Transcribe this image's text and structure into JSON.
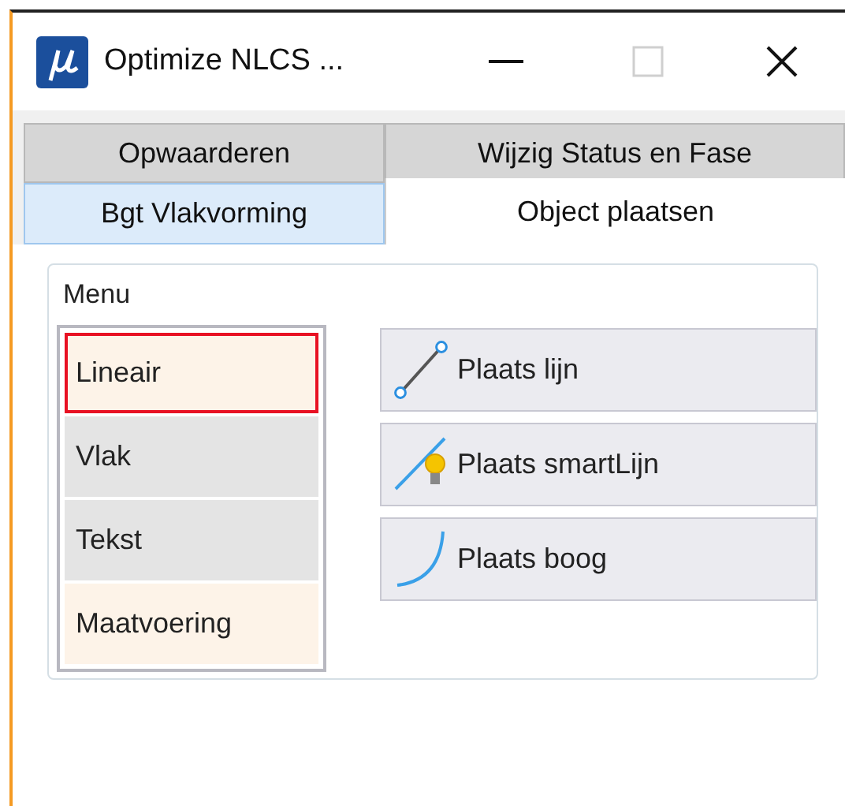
{
  "window": {
    "title": "Optimize NLCS ...",
    "maximize_disabled": true
  },
  "tab_rows": [
    [
      {
        "label": "Opwaarderen",
        "selected": false,
        "hovered": false
      },
      {
        "label": "Wijzig Status en Fase",
        "selected": false,
        "hovered": false
      }
    ],
    [
      {
        "label": "Bgt Vlakvorming",
        "selected": false,
        "hovered": true
      },
      {
        "label": "Object plaatsen",
        "selected": true,
        "hovered": false
      }
    ]
  ],
  "menu": {
    "title": "Menu",
    "items": [
      {
        "label": "Lineair",
        "selected": true,
        "color": "#fdf3e8"
      },
      {
        "label": "Vlak",
        "selected": false,
        "color": "#e4e4e4"
      },
      {
        "label": "Tekst",
        "selected": false,
        "color": "#e4e4e4"
      },
      {
        "label": "Maatvoering",
        "selected": false,
        "color": "#fdf3e8"
      }
    ]
  },
  "actions": [
    {
      "label": "Plaats lijn",
      "kind": "line"
    },
    {
      "label": "Plaats smartLijn",
      "kind": "smartline"
    },
    {
      "label": "Plaats boog",
      "kind": "arc"
    }
  ]
}
